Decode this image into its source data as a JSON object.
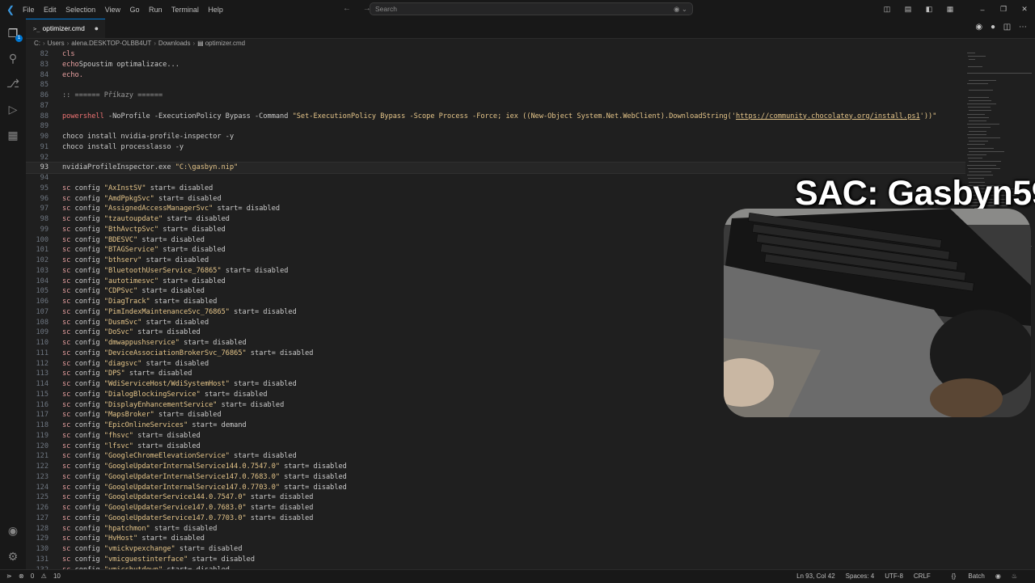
{
  "menu": [
    "File",
    "Edit",
    "Selection",
    "View",
    "Go",
    "Run",
    "Terminal",
    "Help"
  ],
  "search": {
    "placeholder": "Search"
  },
  "tab": {
    "title": "optimizer.cmd"
  },
  "breadcrumb": [
    "C:",
    "Users",
    "alena.DESKTOP-OLBB4UT",
    "Downloads",
    "optimizer.cmd"
  ],
  "activity": {
    "explorer_badge": "1"
  },
  "editor": {
    "current_line": 93,
    "lines": [
      {
        "n": "82",
        "t": [
          [
            "kw",
            "cls"
          ]
        ]
      },
      {
        "n": "83",
        "t": [
          [
            "kw",
            "echo"
          ],
          [
            "",
            "Spoustim optimalizace..."
          ]
        ]
      },
      {
        "n": "84",
        "t": [
          [
            "kw",
            "echo."
          ]
        ]
      },
      {
        "n": "85",
        "t": []
      },
      {
        "n": "86",
        "t": [
          [
            "com",
            ":: ====== Příkazy ======"
          ]
        ]
      },
      {
        "n": "87",
        "t": []
      },
      {
        "n": "88",
        "t": [
          [
            "cmd",
            "powershell"
          ],
          [
            "",
            " -NoProfile -ExecutionPolicy Bypass -Command "
          ],
          [
            "str",
            "\"Set-ExecutionPolicy Bypass -Scope Process -Force; iex ((New-Object System.Net.WebClient).DownloadString('"
          ],
          [
            "url",
            "https://community.chocolatey.org/install.ps1"
          ],
          [
            "str",
            "'))\""
          ]
        ]
      },
      {
        "n": "89",
        "t": []
      },
      {
        "n": "90",
        "t": [
          [
            "",
            "choco install nvidia-profile-inspector -y"
          ]
        ]
      },
      {
        "n": "91",
        "t": [
          [
            "",
            "choco install processlasso -y"
          ]
        ]
      },
      {
        "n": "92",
        "t": []
      },
      {
        "n": "93",
        "t": [
          [
            "",
            "nvidiaProfileInspector.exe "
          ],
          [
            "str",
            "\"C:\\gasbyn.nip\""
          ]
        ]
      },
      {
        "n": "94",
        "t": []
      },
      {
        "n": "95",
        "t": [
          [
            "kw",
            "sc"
          ],
          [
            "",
            " config "
          ],
          [
            "str",
            "\"AxInstSV\""
          ],
          [
            "",
            " start= disabled"
          ]
        ]
      },
      {
        "n": "96",
        "t": [
          [
            "kw",
            "sc"
          ],
          [
            "",
            " config "
          ],
          [
            "str",
            "\"AmdPpkgSvc\""
          ],
          [
            "",
            " start= disabled"
          ]
        ]
      },
      {
        "n": "97",
        "t": [
          [
            "kw",
            "sc"
          ],
          [
            "",
            " config "
          ],
          [
            "str",
            "\"AssignedAccessManagerSvc\""
          ],
          [
            "",
            " start= disabled"
          ]
        ]
      },
      {
        "n": "98",
        "t": [
          [
            "kw",
            "sc"
          ],
          [
            "",
            " config "
          ],
          [
            "str",
            "\"tzautoupdate\""
          ],
          [
            "",
            " start= disabled"
          ]
        ]
      },
      {
        "n": "99",
        "t": [
          [
            "kw",
            "sc"
          ],
          [
            "",
            " config "
          ],
          [
            "str",
            "\"BthAvctpSvc\""
          ],
          [
            "",
            " start= disabled"
          ]
        ]
      },
      {
        "n": "100",
        "t": [
          [
            "kw",
            "sc"
          ],
          [
            "",
            " config "
          ],
          [
            "str",
            "\"BDESVC\""
          ],
          [
            "",
            " start= disabled"
          ]
        ]
      },
      {
        "n": "101",
        "t": [
          [
            "kw",
            "sc"
          ],
          [
            "",
            " config "
          ],
          [
            "str",
            "\"BTAGService\""
          ],
          [
            "",
            " start= disabled"
          ]
        ]
      },
      {
        "n": "102",
        "t": [
          [
            "kw",
            "sc"
          ],
          [
            "",
            " config "
          ],
          [
            "str",
            "\"bthserv\""
          ],
          [
            "",
            " start= disabled"
          ]
        ]
      },
      {
        "n": "103",
        "t": [
          [
            "kw",
            "sc"
          ],
          [
            "",
            " config "
          ],
          [
            "str",
            "\"BluetoothUserService_76865\""
          ],
          [
            "",
            " start= disabled"
          ]
        ]
      },
      {
        "n": "104",
        "t": [
          [
            "kw",
            "sc"
          ],
          [
            "",
            " config "
          ],
          [
            "str",
            "\"autotimesvc\""
          ],
          [
            "",
            " start= disabled"
          ]
        ]
      },
      {
        "n": "105",
        "t": [
          [
            "kw",
            "sc"
          ],
          [
            "",
            " config "
          ],
          [
            "str",
            "\"CDPSvc\""
          ],
          [
            "",
            " start= disabled"
          ]
        ]
      },
      {
        "n": "106",
        "t": [
          [
            "kw",
            "sc"
          ],
          [
            "",
            " config "
          ],
          [
            "str",
            "\"DiagTrack\""
          ],
          [
            "",
            " start= disabled"
          ]
        ]
      },
      {
        "n": "107",
        "t": [
          [
            "kw",
            "sc"
          ],
          [
            "",
            " config "
          ],
          [
            "str",
            "\"PimIndexMaintenanceSvc_76865\""
          ],
          [
            "",
            " start= disabled"
          ]
        ]
      },
      {
        "n": "108",
        "t": [
          [
            "kw",
            "sc"
          ],
          [
            "",
            " config "
          ],
          [
            "str",
            "\"DusmSvc\""
          ],
          [
            "",
            " start= disabled"
          ]
        ]
      },
      {
        "n": "109",
        "t": [
          [
            "kw",
            "sc"
          ],
          [
            "",
            " config "
          ],
          [
            "str",
            "\"DoSvc\""
          ],
          [
            "",
            " start= disabled"
          ]
        ]
      },
      {
        "n": "110",
        "t": [
          [
            "kw",
            "sc"
          ],
          [
            "",
            " config "
          ],
          [
            "str",
            "\"dmwappushservice\""
          ],
          [
            "",
            " start= disabled"
          ]
        ]
      },
      {
        "n": "111",
        "t": [
          [
            "kw",
            "sc"
          ],
          [
            "",
            " config "
          ],
          [
            "str",
            "\"DeviceAssociationBrokerSvc_76865\""
          ],
          [
            "",
            " start= disabled"
          ]
        ]
      },
      {
        "n": "112",
        "t": [
          [
            "kw",
            "sc"
          ],
          [
            "",
            " config "
          ],
          [
            "str",
            "\"diagsvc\""
          ],
          [
            "",
            " start= disabled"
          ]
        ]
      },
      {
        "n": "113",
        "t": [
          [
            "kw",
            "sc"
          ],
          [
            "",
            " config "
          ],
          [
            "str",
            "\"DPS\""
          ],
          [
            "",
            " start= disabled"
          ]
        ]
      },
      {
        "n": "114",
        "t": [
          [
            "kw",
            "sc"
          ],
          [
            "",
            " config "
          ],
          [
            "str",
            "\"WdiServiceHost/WdiSystemHost\""
          ],
          [
            "",
            " start= disabled"
          ]
        ]
      },
      {
        "n": "115",
        "t": [
          [
            "kw",
            "sc"
          ],
          [
            "",
            " config "
          ],
          [
            "str",
            "\"DialogBlockingService\""
          ],
          [
            "",
            " start= disabled"
          ]
        ]
      },
      {
        "n": "116",
        "t": [
          [
            "kw",
            "sc"
          ],
          [
            "",
            " config "
          ],
          [
            "str",
            "\"DisplayEnhancementService\""
          ],
          [
            "",
            " start= disabled"
          ]
        ]
      },
      {
        "n": "117",
        "t": [
          [
            "kw",
            "sc"
          ],
          [
            "",
            " config "
          ],
          [
            "str",
            "\"MapsBroker\""
          ],
          [
            "",
            " start= disabled"
          ]
        ]
      },
      {
        "n": "118",
        "t": [
          [
            "kw",
            "sc"
          ],
          [
            "",
            " config "
          ],
          [
            "str",
            "\"EpicOnlineServices\""
          ],
          [
            "",
            " start= demand"
          ]
        ]
      },
      {
        "n": "119",
        "t": [
          [
            "kw",
            "sc"
          ],
          [
            "",
            " config "
          ],
          [
            "str",
            "\"fhsvc\""
          ],
          [
            "",
            " start= disabled"
          ]
        ]
      },
      {
        "n": "120",
        "t": [
          [
            "kw",
            "sc"
          ],
          [
            "",
            " config "
          ],
          [
            "str",
            "\"lfsvc\""
          ],
          [
            "",
            " start= disabled"
          ]
        ]
      },
      {
        "n": "121",
        "t": [
          [
            "kw",
            "sc"
          ],
          [
            "",
            " config "
          ],
          [
            "str",
            "\"GoogleChromeElevationService\""
          ],
          [
            "",
            " start= disabled"
          ]
        ]
      },
      {
        "n": "122",
        "t": [
          [
            "kw",
            "sc"
          ],
          [
            "",
            " config "
          ],
          [
            "str",
            "\"GoogleUpdaterInternalService144.0.7547.0\""
          ],
          [
            "",
            " start= disabled"
          ]
        ]
      },
      {
        "n": "123",
        "t": [
          [
            "kw",
            "sc"
          ],
          [
            "",
            " config "
          ],
          [
            "str",
            "\"GoogleUpdaterInternalService147.0.7683.0\""
          ],
          [
            "",
            " start= disabled"
          ]
        ]
      },
      {
        "n": "124",
        "t": [
          [
            "kw",
            "sc"
          ],
          [
            "",
            " config "
          ],
          [
            "str",
            "\"GoogleUpdaterInternalService147.0.7703.0\""
          ],
          [
            "",
            " start= disabled"
          ]
        ]
      },
      {
        "n": "125",
        "t": [
          [
            "kw",
            "sc"
          ],
          [
            "",
            " config "
          ],
          [
            "str",
            "\"GoogleUpdaterService144.0.7547.0\""
          ],
          [
            "",
            " start= disabled"
          ]
        ]
      },
      {
        "n": "126",
        "t": [
          [
            "kw",
            "sc"
          ],
          [
            "",
            " config "
          ],
          [
            "str",
            "\"GoogleUpdaterService147.0.7683.0\""
          ],
          [
            "",
            " start= disabled"
          ]
        ]
      },
      {
        "n": "127",
        "t": [
          [
            "kw",
            "sc"
          ],
          [
            "",
            " config "
          ],
          [
            "str",
            "\"GoogleUpdaterService147.0.7703.0\""
          ],
          [
            "",
            " start= disabled"
          ]
        ]
      },
      {
        "n": "128",
        "t": [
          [
            "kw",
            "sc"
          ],
          [
            "",
            " config "
          ],
          [
            "str",
            "\"hpatchmon\""
          ],
          [
            "",
            " start= disabled"
          ]
        ]
      },
      {
        "n": "129",
        "t": [
          [
            "kw",
            "sc"
          ],
          [
            "",
            " config "
          ],
          [
            "str",
            "\"HvHost\""
          ],
          [
            "",
            " start= disabled"
          ]
        ]
      },
      {
        "n": "130",
        "t": [
          [
            "kw",
            "sc"
          ],
          [
            "",
            " config "
          ],
          [
            "str",
            "\"vmickvpexchange\""
          ],
          [
            "",
            " start= disabled"
          ]
        ]
      },
      {
        "n": "131",
        "t": [
          [
            "kw",
            "sc"
          ],
          [
            "",
            " config "
          ],
          [
            "str",
            "\"vmicguestinterface\""
          ],
          [
            "",
            " start= disabled"
          ]
        ]
      },
      {
        "n": "132",
        "t": [
          [
            "kw",
            "sc"
          ],
          [
            "",
            " config "
          ],
          [
            "str",
            "\"vmicshutdown\""
          ],
          [
            "",
            " start= disabled"
          ]
        ]
      }
    ]
  },
  "status": {
    "errors": "0",
    "warnings": "10",
    "position": "Ln 93, Col 42",
    "spaces": "Spaces: 4",
    "encoding": "UTF-8",
    "eol": "CRLF",
    "language": "Batch"
  },
  "overlay": {
    "text": "SAC: Gasbyn59"
  },
  "colors": {
    "accent": "#0078d4",
    "string": "#e6c68a",
    "keyword": "#e8a0a0"
  }
}
